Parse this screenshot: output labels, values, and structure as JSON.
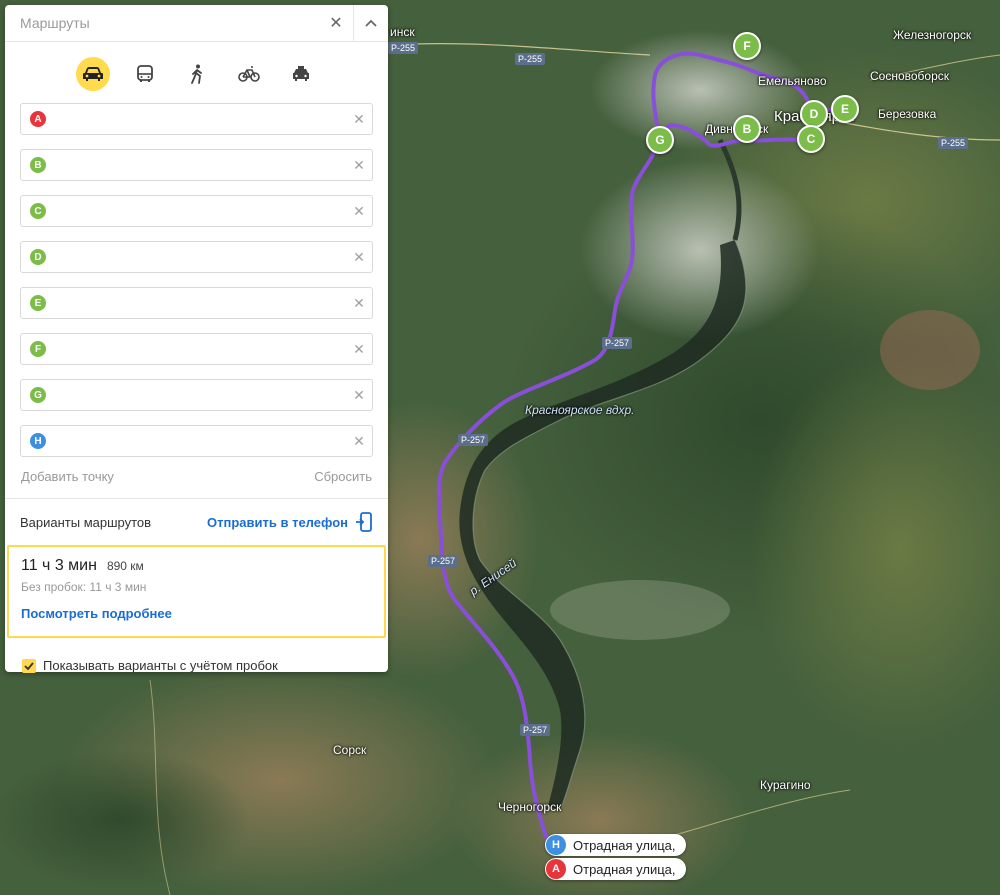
{
  "panel": {
    "title": "Маршруты",
    "modes": [
      {
        "name": "car-icon",
        "active": true
      },
      {
        "name": "bus-icon",
        "active": false
      },
      {
        "name": "walk-icon",
        "active": false
      },
      {
        "name": "bike-icon",
        "active": false
      },
      {
        "name": "taxi-icon",
        "active": false
      }
    ],
    "waypoints": [
      {
        "letter": "A",
        "color": "#e8353b",
        "value": ""
      },
      {
        "letter": "B",
        "color": "#7cbd4a",
        "value": ""
      },
      {
        "letter": "C",
        "color": "#7cbd4a",
        "value": ""
      },
      {
        "letter": "D",
        "color": "#7cbd4a",
        "value": ""
      },
      {
        "letter": "E",
        "color": "#7cbd4a",
        "value": ""
      },
      {
        "letter": "F",
        "color": "#7cbd4a",
        "value": ""
      },
      {
        "letter": "G",
        "color": "#7cbd4a",
        "value": ""
      },
      {
        "letter": "H",
        "color": "#3d8fe0",
        "value": ""
      }
    ],
    "add_point": "Добавить точку",
    "reset": "Сбросить",
    "variants_label": "Варианты маршрутов",
    "send_to_phone": "Отправить в телефон",
    "route": {
      "time": "11 ч 3 мин",
      "distance": "890 км",
      "no_jams": "Без пробок: 11 ч 3 мин",
      "details": "Посмотреть подробнее"
    },
    "traffic_checkbox": "Показывать варианты с учётом пробок",
    "traffic_checked": true
  },
  "map": {
    "labels": {
      "zheleznogorsk": "Железногорск",
      "sosnovoborsk": "Сосновоборск",
      "berezovka": "Березовка",
      "emelyanovo": "Емельяново",
      "divnogorsk": "Дивногорск",
      "krasnoyarsk": "Красноярск",
      "reservoir": "Красноярское вдхр.",
      "yenisei": "р. Енисей",
      "chernogorsk": "Черногорск",
      "kuragino": "Курагино",
      "sorsk": "Сорск",
      "achinsk": "инск"
    },
    "roads": {
      "r255": "Р-255",
      "r257": "Р-257"
    },
    "end_tags": {
      "h_label": "Отрадная улица,",
      "a_label": "Отрадная улица,"
    }
  }
}
